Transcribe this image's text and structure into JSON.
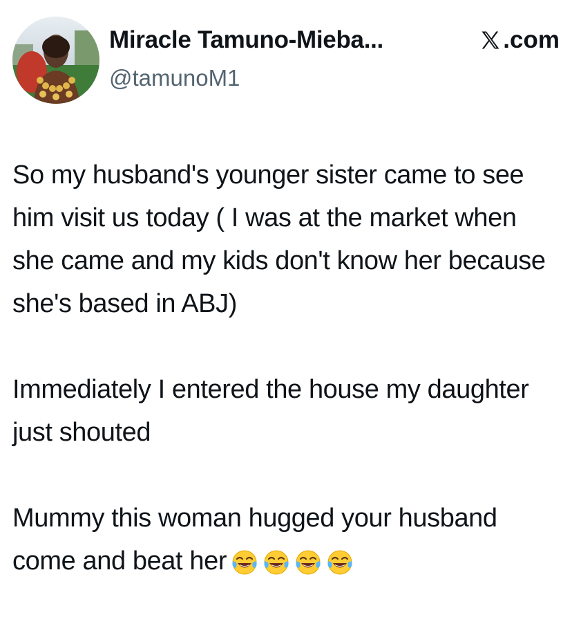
{
  "author": {
    "display_name": "Miracle Tamuno-Mieba...",
    "handle": "@tamunoM1",
    "avatar_icon": "profile-photo"
  },
  "source": {
    "logo_icon": "x-logo-icon",
    "label": ".com"
  },
  "tweet": {
    "paragraphs": [
      "So my husband's younger sister came to see him visit us today ( I was at the market when she came and my kids don't know her because she's based in ABJ)",
      "Immediately I entered the house my daughter just shouted",
      "Mummy this woman hugged your husband come and beat her"
    ],
    "emojis": [
      "face-with-tears-of-joy-icon",
      "face-with-tears-of-joy-icon",
      "face-with-tears-of-joy-icon",
      "face-with-tears-of-joy-icon"
    ]
  },
  "colors": {
    "text": "#0f1419",
    "secondary_text": "#536471",
    "background": "#ffffff"
  }
}
